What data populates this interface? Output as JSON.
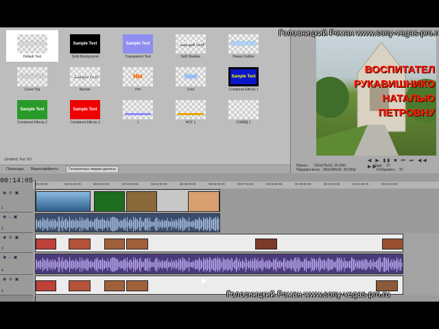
{
  "watermark_top": "Голосницкий Роман www.sony-vegas-pro.ru",
  "watermark_bottom": "Голосницкий Роман www.sony-vegas-pro.ru",
  "media_generators": {
    "presets": [
      {
        "label": "Default Text",
        "thumb_text": "Sample Text",
        "style": "default",
        "selected": true
      },
      {
        "label": "Solid Background",
        "thumb_text": "Sample Text",
        "style": "solid"
      },
      {
        "label": "Transparent Text",
        "thumb_text": "Sample Text",
        "style": "transparent"
      },
      {
        "label": "Soft Shadow",
        "thumb_text": "Sample Text",
        "style": "shadow"
      },
      {
        "label": "Heavy Outline",
        "thumb_text": "Sample Text",
        "style": "outline"
      },
      {
        "label": "Curve Top",
        "thumb_text": "Sample Text",
        "style": "curve"
      },
      {
        "label": "Banner",
        "thumb_text": "Sample Text",
        "style": "banner"
      },
      {
        "label": "Hot",
        "thumb_text": "Hot",
        "style": "hot"
      },
      {
        "label": "Cool",
        "thumb_text": "Cool",
        "style": "cool"
      },
      {
        "label": "Combined Effects 1",
        "thumb_text": "Sample Text",
        "style": "combined1"
      },
      {
        "label": "Combined Effects 2",
        "thumb_text": "Sample Text",
        "style": "combined2"
      },
      {
        "label": "Combined Effects 3",
        "thumb_text": "Sample Text",
        "style": "combined3"
      },
      {
        "label": "1",
        "thumb_text": "",
        "style": "custom1"
      },
      {
        "label": "HOT 1",
        "thumb_text": "",
        "style": "custom2"
      },
      {
        "label": "СЛАЙД 1",
        "thumb_text": "",
        "style": "custom3"
      }
    ],
    "status": "(Untitled) Text: 8/1",
    "tabs": [
      {
        "label": "Переходы",
        "active": false
      },
      {
        "label": "Видеоэффекты",
        "active": false
      },
      {
        "label": "Генераторы медиа-данных",
        "active": true
      }
    ]
  },
  "preview": {
    "overlay_lines": [
      "ВОСПИТАТЕЛ",
      "РУКАВИШНИКО",
      "НАТАЛЬЮ",
      "ПЕТРОВНУ"
    ],
    "project_label": "Проект:",
    "project_value": "720x576x32; 25,000i",
    "preview_label": "Предпросмотр:",
    "preview_value": "360x288x32; 25,000p",
    "frame_label": "Кадр:",
    "frame_value": "37",
    "display_label": "Отобразить:",
    "display_value": "97",
    "transport": "◀ ▶ ▮▮ ■ ⏮ ⏭ ◀◀ ▶▶"
  },
  "timeline": {
    "time_display": "00:14:05",
    "ruler_ticks": [
      "00:00:00",
      "00:01:00:00",
      "00:02:00:00",
      "00:03:00:00",
      "00:04:00:00",
      "00:05:00:00",
      "00:06:00:00",
      "00:07:00:00",
      "00:08:00:00",
      "00:09:00:00",
      "00:10:00:00",
      "00:11:00:00",
      "00:12:00:00"
    ],
    "tracks": [
      {
        "num": "1",
        "kind": "video"
      },
      {
        "num": "2",
        "kind": "audio"
      },
      {
        "num": "3",
        "kind": "video"
      },
      {
        "num": "4",
        "kind": "audio"
      },
      {
        "num": "5",
        "kind": "video"
      }
    ]
  }
}
